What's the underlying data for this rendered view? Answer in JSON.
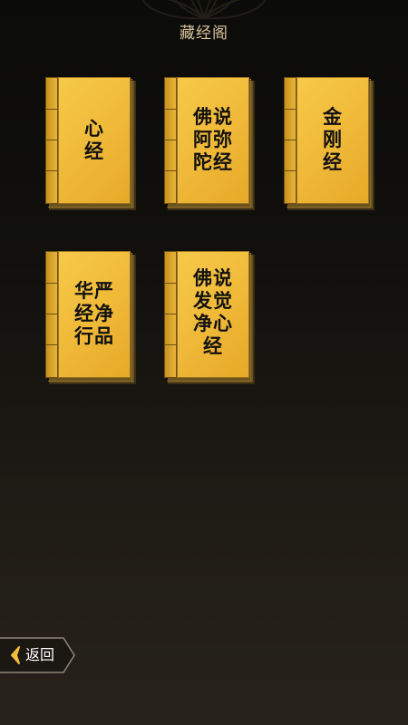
{
  "header": {
    "title": "藏经阁"
  },
  "books": [
    {
      "lines": [
        "心",
        "经"
      ]
    },
    {
      "lines": [
        "佛说",
        "阿弥",
        "陀经"
      ]
    },
    {
      "lines": [
        "金",
        "刚",
        "经"
      ]
    },
    {
      "lines": [
        "华严",
        "经净",
        "行品"
      ]
    },
    {
      "lines": [
        "佛说",
        "发觉",
        "净心",
        "经"
      ]
    }
  ],
  "footer": {
    "back_label": "返回"
  },
  "colors": {
    "accent_gold": "#f2bd3c",
    "title_text": "#d9c59a",
    "background_dark": "#0b0b0a"
  }
}
